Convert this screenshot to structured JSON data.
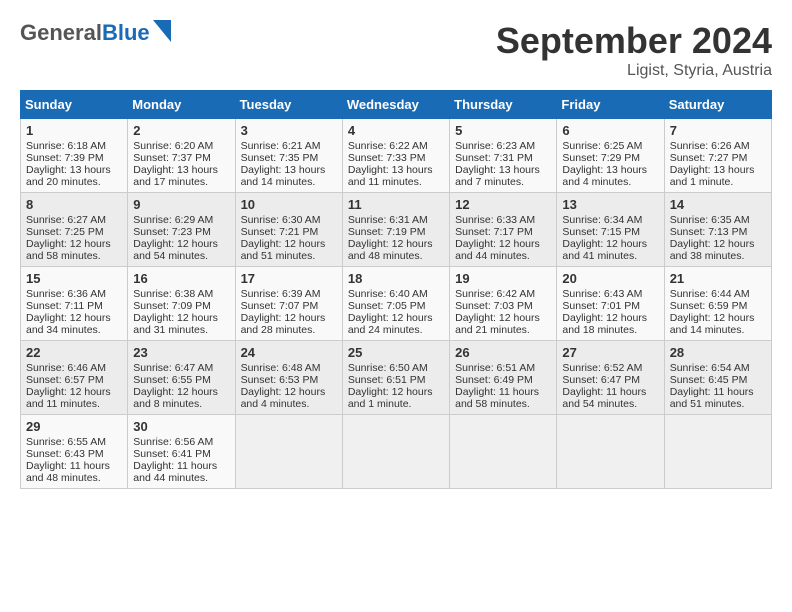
{
  "header": {
    "logo_line1": "General",
    "logo_line2": "Blue",
    "month": "September 2024",
    "location": "Ligist, Styria, Austria"
  },
  "weekdays": [
    "Sunday",
    "Monday",
    "Tuesday",
    "Wednesday",
    "Thursday",
    "Friday",
    "Saturday"
  ],
  "weeks": [
    [
      {
        "day": "1",
        "lines": [
          "Sunrise: 6:18 AM",
          "Sunset: 7:39 PM",
          "Daylight: 13 hours",
          "and 20 minutes."
        ]
      },
      {
        "day": "2",
        "lines": [
          "Sunrise: 6:20 AM",
          "Sunset: 7:37 PM",
          "Daylight: 13 hours",
          "and 17 minutes."
        ]
      },
      {
        "day": "3",
        "lines": [
          "Sunrise: 6:21 AM",
          "Sunset: 7:35 PM",
          "Daylight: 13 hours",
          "and 14 minutes."
        ]
      },
      {
        "day": "4",
        "lines": [
          "Sunrise: 6:22 AM",
          "Sunset: 7:33 PM",
          "Daylight: 13 hours",
          "and 11 minutes."
        ]
      },
      {
        "day": "5",
        "lines": [
          "Sunrise: 6:23 AM",
          "Sunset: 7:31 PM",
          "Daylight: 13 hours",
          "and 7 minutes."
        ]
      },
      {
        "day": "6",
        "lines": [
          "Sunrise: 6:25 AM",
          "Sunset: 7:29 PM",
          "Daylight: 13 hours",
          "and 4 minutes."
        ]
      },
      {
        "day": "7",
        "lines": [
          "Sunrise: 6:26 AM",
          "Sunset: 7:27 PM",
          "Daylight: 13 hours",
          "and 1 minute."
        ]
      }
    ],
    [
      {
        "day": "8",
        "lines": [
          "Sunrise: 6:27 AM",
          "Sunset: 7:25 PM",
          "Daylight: 12 hours",
          "and 58 minutes."
        ]
      },
      {
        "day": "9",
        "lines": [
          "Sunrise: 6:29 AM",
          "Sunset: 7:23 PM",
          "Daylight: 12 hours",
          "and 54 minutes."
        ]
      },
      {
        "day": "10",
        "lines": [
          "Sunrise: 6:30 AM",
          "Sunset: 7:21 PM",
          "Daylight: 12 hours",
          "and 51 minutes."
        ]
      },
      {
        "day": "11",
        "lines": [
          "Sunrise: 6:31 AM",
          "Sunset: 7:19 PM",
          "Daylight: 12 hours",
          "and 48 minutes."
        ]
      },
      {
        "day": "12",
        "lines": [
          "Sunrise: 6:33 AM",
          "Sunset: 7:17 PM",
          "Daylight: 12 hours",
          "and 44 minutes."
        ]
      },
      {
        "day": "13",
        "lines": [
          "Sunrise: 6:34 AM",
          "Sunset: 7:15 PM",
          "Daylight: 12 hours",
          "and 41 minutes."
        ]
      },
      {
        "day": "14",
        "lines": [
          "Sunrise: 6:35 AM",
          "Sunset: 7:13 PM",
          "Daylight: 12 hours",
          "and 38 minutes."
        ]
      }
    ],
    [
      {
        "day": "15",
        "lines": [
          "Sunrise: 6:36 AM",
          "Sunset: 7:11 PM",
          "Daylight: 12 hours",
          "and 34 minutes."
        ]
      },
      {
        "day": "16",
        "lines": [
          "Sunrise: 6:38 AM",
          "Sunset: 7:09 PM",
          "Daylight: 12 hours",
          "and 31 minutes."
        ]
      },
      {
        "day": "17",
        "lines": [
          "Sunrise: 6:39 AM",
          "Sunset: 7:07 PM",
          "Daylight: 12 hours",
          "and 28 minutes."
        ]
      },
      {
        "day": "18",
        "lines": [
          "Sunrise: 6:40 AM",
          "Sunset: 7:05 PM",
          "Daylight: 12 hours",
          "and 24 minutes."
        ]
      },
      {
        "day": "19",
        "lines": [
          "Sunrise: 6:42 AM",
          "Sunset: 7:03 PM",
          "Daylight: 12 hours",
          "and 21 minutes."
        ]
      },
      {
        "day": "20",
        "lines": [
          "Sunrise: 6:43 AM",
          "Sunset: 7:01 PM",
          "Daylight: 12 hours",
          "and 18 minutes."
        ]
      },
      {
        "day": "21",
        "lines": [
          "Sunrise: 6:44 AM",
          "Sunset: 6:59 PM",
          "Daylight: 12 hours",
          "and 14 minutes."
        ]
      }
    ],
    [
      {
        "day": "22",
        "lines": [
          "Sunrise: 6:46 AM",
          "Sunset: 6:57 PM",
          "Daylight: 12 hours",
          "and 11 minutes."
        ]
      },
      {
        "day": "23",
        "lines": [
          "Sunrise: 6:47 AM",
          "Sunset: 6:55 PM",
          "Daylight: 12 hours",
          "and 8 minutes."
        ]
      },
      {
        "day": "24",
        "lines": [
          "Sunrise: 6:48 AM",
          "Sunset: 6:53 PM",
          "Daylight: 12 hours",
          "and 4 minutes."
        ]
      },
      {
        "day": "25",
        "lines": [
          "Sunrise: 6:50 AM",
          "Sunset: 6:51 PM",
          "Daylight: 12 hours",
          "and 1 minute."
        ]
      },
      {
        "day": "26",
        "lines": [
          "Sunrise: 6:51 AM",
          "Sunset: 6:49 PM",
          "Daylight: 11 hours",
          "and 58 minutes."
        ]
      },
      {
        "day": "27",
        "lines": [
          "Sunrise: 6:52 AM",
          "Sunset: 6:47 PM",
          "Daylight: 11 hours",
          "and 54 minutes."
        ]
      },
      {
        "day": "28",
        "lines": [
          "Sunrise: 6:54 AM",
          "Sunset: 6:45 PM",
          "Daylight: 11 hours",
          "and 51 minutes."
        ]
      }
    ],
    [
      {
        "day": "29",
        "lines": [
          "Sunrise: 6:55 AM",
          "Sunset: 6:43 PM",
          "Daylight: 11 hours",
          "and 48 minutes."
        ]
      },
      {
        "day": "30",
        "lines": [
          "Sunrise: 6:56 AM",
          "Sunset: 6:41 PM",
          "Daylight: 11 hours",
          "and 44 minutes."
        ]
      },
      {
        "day": "",
        "lines": []
      },
      {
        "day": "",
        "lines": []
      },
      {
        "day": "",
        "lines": []
      },
      {
        "day": "",
        "lines": []
      },
      {
        "day": "",
        "lines": []
      }
    ]
  ]
}
